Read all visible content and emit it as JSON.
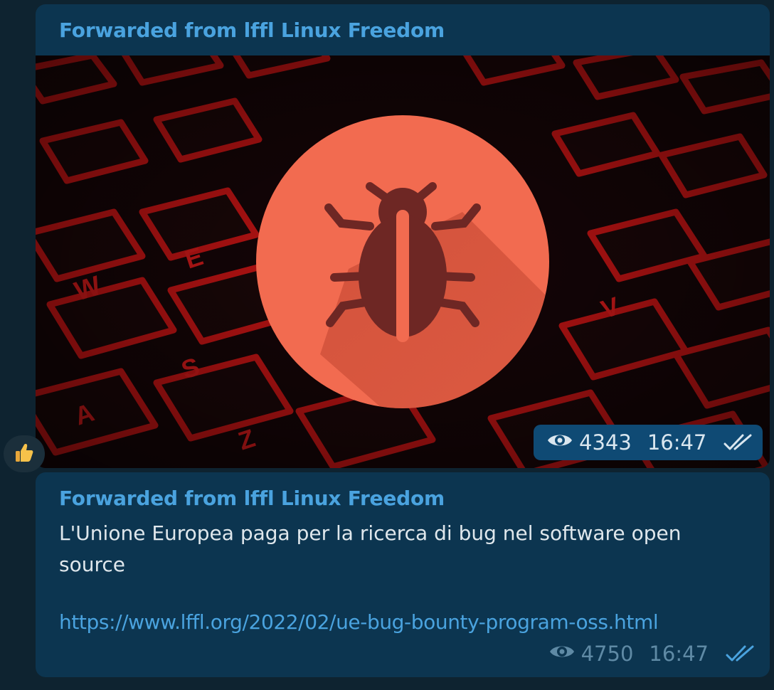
{
  "messages": [
    {
      "forwarded_from": "Forwarded from lffl Linux Freedom",
      "media": "bug-icon-over-red-keyboard-photo",
      "views": "4343",
      "time": "16:47",
      "status": "read"
    },
    {
      "forwarded_from": "Forwarded from lffl Linux Freedom",
      "text": "L'Unione Europea paga per la ricerca di bug nel software open source",
      "link": "https://www.lffl.org/2022/02/ue-bug-bounty-program-oss.html",
      "views": "4750",
      "time": "16:47",
      "status": "read"
    }
  ],
  "reaction": {
    "emoji": "👍",
    "icon": "thumbs-up-icon"
  },
  "colors": {
    "background": "#0e2330",
    "bubble": "#0c3550",
    "accent": "#4aa3df",
    "text": "#dfe7ec",
    "meta": "#5f8aa5",
    "bug_circle": "#f26b50",
    "bug_body": "#7a2a27"
  }
}
